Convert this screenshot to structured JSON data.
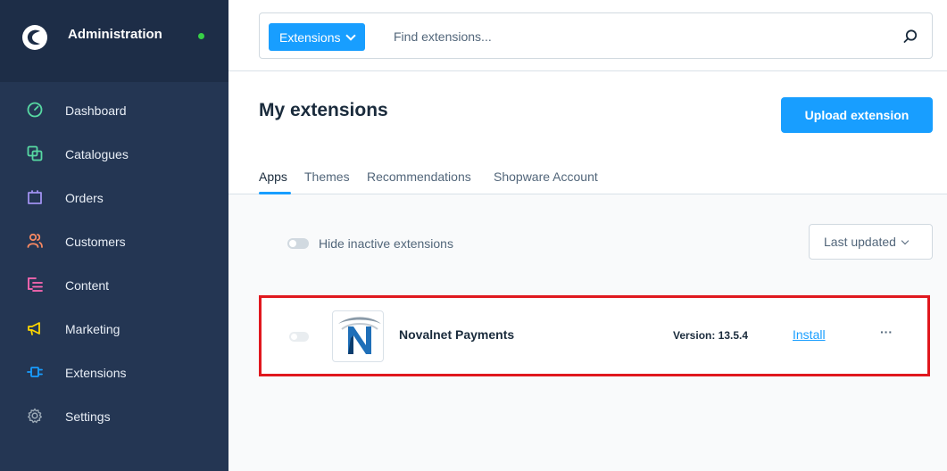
{
  "app": {
    "title": "Administration"
  },
  "sidebar": {
    "items": [
      {
        "label": "Dashboard",
        "icon": "dashboard-icon",
        "color": "#57d9a3"
      },
      {
        "label": "Catalogues",
        "icon": "catalogues-icon",
        "color": "#57d9a3"
      },
      {
        "label": "Orders",
        "icon": "orders-icon",
        "color": "#a092f0"
      },
      {
        "label": "Customers",
        "icon": "customers-icon",
        "color": "#f88962"
      },
      {
        "label": "Content",
        "icon": "content-icon",
        "color": "#ff68b4"
      },
      {
        "label": "Marketing",
        "icon": "marketing-icon",
        "color": "#ffd700"
      },
      {
        "label": "Extensions",
        "icon": "extensions-icon",
        "color": "#189eff"
      },
      {
        "label": "Settings",
        "icon": "settings-icon",
        "color": "#9aa8b5"
      }
    ]
  },
  "search": {
    "scope": "Extensions",
    "placeholder": "Find extensions..."
  },
  "page": {
    "title": "My extensions",
    "upload_label": "Upload extension"
  },
  "tabs": [
    "Apps",
    "Themes",
    "Recommendations",
    "Shopware Account"
  ],
  "filters": {
    "hide_inactive_label": "Hide inactive extensions",
    "sort_label": "Last updated"
  },
  "extension": {
    "name": "Novalnet Payments",
    "version": "Version: 13.5.4",
    "install_label": "Install",
    "more_label": "···"
  },
  "colors": {
    "accent": "#189eff",
    "sidebar_bg": "#243653",
    "highlight": "#e0181e"
  }
}
